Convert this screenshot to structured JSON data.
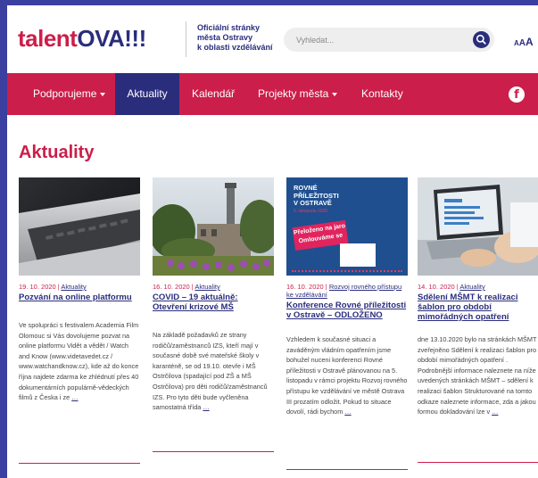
{
  "header": {
    "logo_part1": "talent",
    "logo_part2": "OVA",
    "logo_part3": "!!!",
    "tagline_line1": "Oficiální stránky",
    "tagline_line2": "města Ostravy",
    "tagline_line3": "k oblasti vzdělávání",
    "search_placeholder": "Vyhledat...",
    "font_size_labels": [
      "A",
      "A",
      "A"
    ]
  },
  "nav": {
    "items": [
      {
        "label": "Podporujeme",
        "has_dropdown": true
      },
      {
        "label": "Aktuality",
        "active": true
      },
      {
        "label": "Kalendář"
      },
      {
        "label": "Projekty města",
        "has_dropdown": true
      },
      {
        "label": "Kontakty"
      }
    ],
    "facebook_glyph": "f"
  },
  "main": {
    "title": "Aktuality",
    "cards": [
      {
        "date": "19. 10. 2020",
        "category": "Aktuality",
        "title": "Pozvání na online platformu",
        "text": "Ve spolupráci s festivalem Academia Film Olomouc si Vás dovolujeme pozvat na online platformu Vidět a vědět / Watch and Know (www.videtavedet.cz / www.watchandknow.cz), kde až do konce října najdete zdarma ke zhlédnutí přes 40 dokumentárních populárně-vědeckých filmů z Česka i ze",
        "more": "…"
      },
      {
        "date": "16. 10. 2020",
        "category": "Aktuality",
        "title": "COVID – 19 aktuálně: Otevření krizové MŠ",
        "text": "Na základě požadavků ze strany rodičů/zaměstnanců IZS, kteří mají v současné době své mateřské školy v karanténě, se od 19.10. otevře i MŠ Ostrčilova (spadající pod ZŠ a MŠ Ostrčilova) pro děti rodičů/zaměstnanců IZS. Pro tyto děti bude vyčleněna samostatná třída",
        "more": "…"
      },
      {
        "date": "16. 10. 2020",
        "category": "Rozvoj rovného přístupu ke vzdělávání",
        "title": "Konference Rovné příležitosti v Ostravě – ODLOŽENO",
        "text": "Vzhledem k současné situaci a zaváděným vládním opatřením jsme bohužel nuceni konferenci Rovné příležitosti v Ostravě plánovanou na 5. listopadu v rámci projektu Rozvoj rovného přístupu ke vzdělávání ve městě Ostrava III prozatím odložit. Pokud to situace dovolí, rádi bychom",
        "more": "…"
      },
      {
        "date": "14. 10. 2020",
        "category": "Aktuality",
        "title": "Sdělení MŠMT k realizaci šablon pro období mimořádných opatření",
        "text": "dne 13.10.2020 bylo na stránkách MŠMT zveřejněno Sdělení k realizaci šablon pro období mimořádných opatření . Podrobnější informace naleznete na níže uvedených stránkách MŠMT – sdělení k realizaci šablon Strukturované na tomto odkaze naleznete informace, zda a jakou formou dokladování lze v",
        "more": "…"
      }
    ],
    "poster_text": {
      "line1": "ROVNÉ",
      "line2": "PŘÍLEŽITOSTI",
      "line3": "V OSTRAVĚ",
      "date": "5. listopadu 2020",
      "banner1": "Přeloženo na jaro",
      "banner2": "Omlouváme se"
    }
  },
  "colors": {
    "brand_red": "#cc1e4a",
    "brand_navy": "#2a2d7c",
    "outer_frame": "#3b3f9f"
  }
}
